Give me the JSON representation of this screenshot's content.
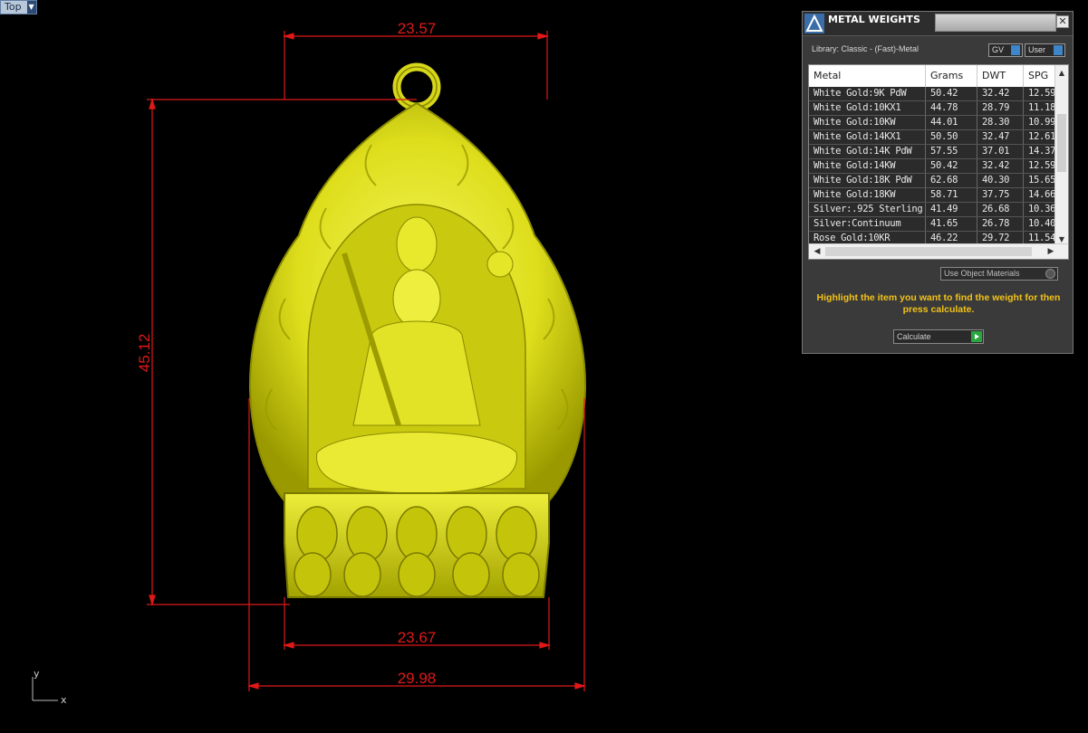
{
  "viewport": {
    "name": "Top"
  },
  "dimensions": {
    "top_width": "23.57",
    "height": "45.12",
    "base_width": "23.67",
    "overall_width": "29.98"
  },
  "axes": {
    "y": "y",
    "x": "x"
  },
  "panel": {
    "title": "METAL WEIGHTS",
    "library_label": "Library: Classic - (Fast)-Metal",
    "gv_label": "GV",
    "user_label": "User",
    "columns": [
      "Metal",
      "Grams",
      "DWT",
      "SPG"
    ],
    "rows": [
      [
        "White Gold:9K PdW",
        "50.42",
        "32.42",
        "12.59"
      ],
      [
        "White Gold:10KX1",
        "44.78",
        "28.79",
        "11.18"
      ],
      [
        "White Gold:10KW",
        "44.01",
        "28.30",
        "10.99"
      ],
      [
        "White Gold:14KX1",
        "50.50",
        "32.47",
        "12.61"
      ],
      [
        "White Gold:14K PdW",
        "57.55",
        "37.01",
        "14.37"
      ],
      [
        "White Gold:14KW",
        "50.42",
        "32.42",
        "12.59"
      ],
      [
        "White Gold:18K PdW",
        "62.68",
        "40.30",
        "15.65"
      ],
      [
        "White Gold:18KW",
        "58.71",
        "37.75",
        "14.66"
      ],
      [
        "Silver:.925 Sterling",
        "41.49",
        "26.68",
        "10.36"
      ],
      [
        "Silver:Continuum",
        "41.65",
        "26.78",
        "10.40"
      ],
      [
        "Rose Gold:10KR",
        "46.22",
        "29.72",
        "11.54"
      ]
    ],
    "use_object_materials": "Use Object Materials",
    "hint": "Highlight the item you want to find the weight for then press calculate.",
    "calculate_label": "Calculate"
  },
  "colors": {
    "dimension": "#e01818",
    "model": "#e6e600",
    "hint": "#f2c318"
  }
}
